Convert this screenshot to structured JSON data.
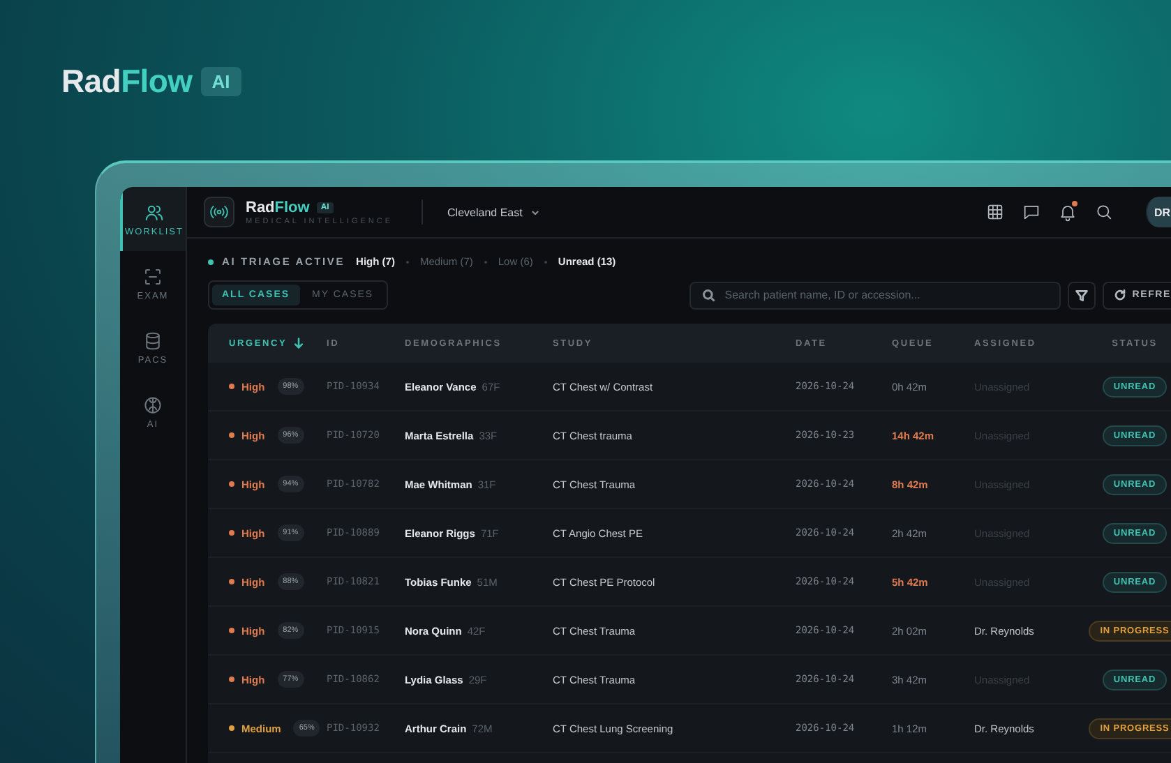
{
  "brand": {
    "name_first": "Rad",
    "name_second": "Flow",
    "badge": "AI"
  },
  "app": {
    "logo": {
      "name_first": "Rad",
      "name_second": "Flow",
      "badge": "AI",
      "tagline": "MEDICAL INTELLIGENCE"
    },
    "location": "Cleveland East",
    "notifications_unread": true,
    "avatar": "DR",
    "sidebar": [
      {
        "label": "WORKLIST",
        "selected": true
      },
      {
        "label": "EXAM",
        "selected": false
      },
      {
        "label": "PACS",
        "selected": false
      },
      {
        "label": "AI",
        "selected": false
      }
    ],
    "triage": {
      "label": "AI TRIAGE ACTIVE",
      "filters": [
        {
          "label": "High (7)",
          "active": true
        },
        {
          "label": "Medium (7)",
          "active": false
        },
        {
          "label": "Low (6)",
          "active": false
        },
        {
          "label": "Unread (13)",
          "active": true
        }
      ]
    },
    "tabs": [
      {
        "label": "ALL CASES",
        "selected": true
      },
      {
        "label": "MY CASES",
        "selected": false
      }
    ],
    "search": {
      "placeholder": "Search patient name, ID or accession..."
    },
    "refresh_button": "REFRE",
    "table": {
      "columns": [
        {
          "label": "URGENCY",
          "sorted": true
        },
        {
          "label": "ID",
          "sorted": false
        },
        {
          "label": "DEMOGRAPHICS",
          "sorted": false
        },
        {
          "label": "STUDY",
          "sorted": false
        },
        {
          "label": "DATE",
          "sorted": false
        },
        {
          "label": "QUEUE",
          "sorted": false
        },
        {
          "label": "ASSIGNED",
          "sorted": false
        },
        {
          "label": "STATUS",
          "sorted": false
        }
      ],
      "rows": [
        {
          "urgency": {
            "label": "High",
            "kind": "high"
          },
          "confidence": "98%",
          "id": "PID-10934",
          "name": "Eleanor Vance",
          "demo": "67F",
          "study": "CT Chest w/ Contrast",
          "date": "2026-10-24",
          "queue": "0h 42m",
          "overdue": false,
          "assigned": "Unassigned",
          "unassigned": true,
          "status": {
            "label": "UNREAD",
            "kind": "unread"
          }
        },
        {
          "urgency": {
            "label": "High",
            "kind": "high"
          },
          "confidence": "96%",
          "id": "PID-10720",
          "name": "Marta Estrella",
          "demo": "33F",
          "study": "CT Chest trauma",
          "date": "2026-10-23",
          "queue": "14h 42m",
          "overdue": true,
          "assigned": "Unassigned",
          "unassigned": true,
          "status": {
            "label": "UNREAD",
            "kind": "unread"
          }
        },
        {
          "urgency": {
            "label": "High",
            "kind": "high"
          },
          "confidence": "94%",
          "id": "PID-10782",
          "name": "Mae Whitman",
          "demo": "31F",
          "study": "CT Chest Trauma",
          "date": "2026-10-24",
          "queue": "8h 42m",
          "overdue": true,
          "assigned": "Unassigned",
          "unassigned": true,
          "status": {
            "label": "UNREAD",
            "kind": "unread"
          }
        },
        {
          "urgency": {
            "label": "High",
            "kind": "high"
          },
          "confidence": "91%",
          "id": "PID-10889",
          "name": "Eleanor Riggs",
          "demo": "71F",
          "study": "CT Angio Chest PE",
          "date": "2026-10-24",
          "queue": "2h 42m",
          "overdue": false,
          "assigned": "Unassigned",
          "unassigned": true,
          "status": {
            "label": "UNREAD",
            "kind": "unread"
          }
        },
        {
          "urgency": {
            "label": "High",
            "kind": "high"
          },
          "confidence": "88%",
          "id": "PID-10821",
          "name": "Tobias Funke",
          "demo": "51M",
          "study": "CT Chest PE Protocol",
          "date": "2026-10-24",
          "queue": "5h 42m",
          "overdue": true,
          "assigned": "Unassigned",
          "unassigned": true,
          "status": {
            "label": "UNREAD",
            "kind": "unread"
          }
        },
        {
          "urgency": {
            "label": "High",
            "kind": "high"
          },
          "confidence": "82%",
          "id": "PID-10915",
          "name": "Nora Quinn",
          "demo": "42F",
          "study": "CT Chest Trauma",
          "date": "2026-10-24",
          "queue": "2h 02m",
          "overdue": false,
          "assigned": "Dr. Reynolds",
          "unassigned": false,
          "status": {
            "label": "IN PROGRESS",
            "kind": "in_progress"
          }
        },
        {
          "urgency": {
            "label": "High",
            "kind": "high"
          },
          "confidence": "77%",
          "id": "PID-10862",
          "name": "Lydia Glass",
          "demo": "29F",
          "study": "CT Chest Trauma",
          "date": "2026-10-24",
          "queue": "3h 42m",
          "overdue": false,
          "assigned": "Unassigned",
          "unassigned": true,
          "status": {
            "label": "UNREAD",
            "kind": "unread"
          }
        },
        {
          "urgency": {
            "label": "Medium",
            "kind": "medium"
          },
          "confidence": "65%",
          "id": "PID-10932",
          "name": "Arthur Crain",
          "demo": "72M",
          "study": "CT Chest Lung Screening",
          "date": "2026-10-24",
          "queue": "1h 12m",
          "overdue": false,
          "assigned": "Dr. Reynolds",
          "unassigned": false,
          "status": {
            "label": "IN PROGRESS",
            "kind": "in_progress"
          }
        }
      ]
    }
  }
}
